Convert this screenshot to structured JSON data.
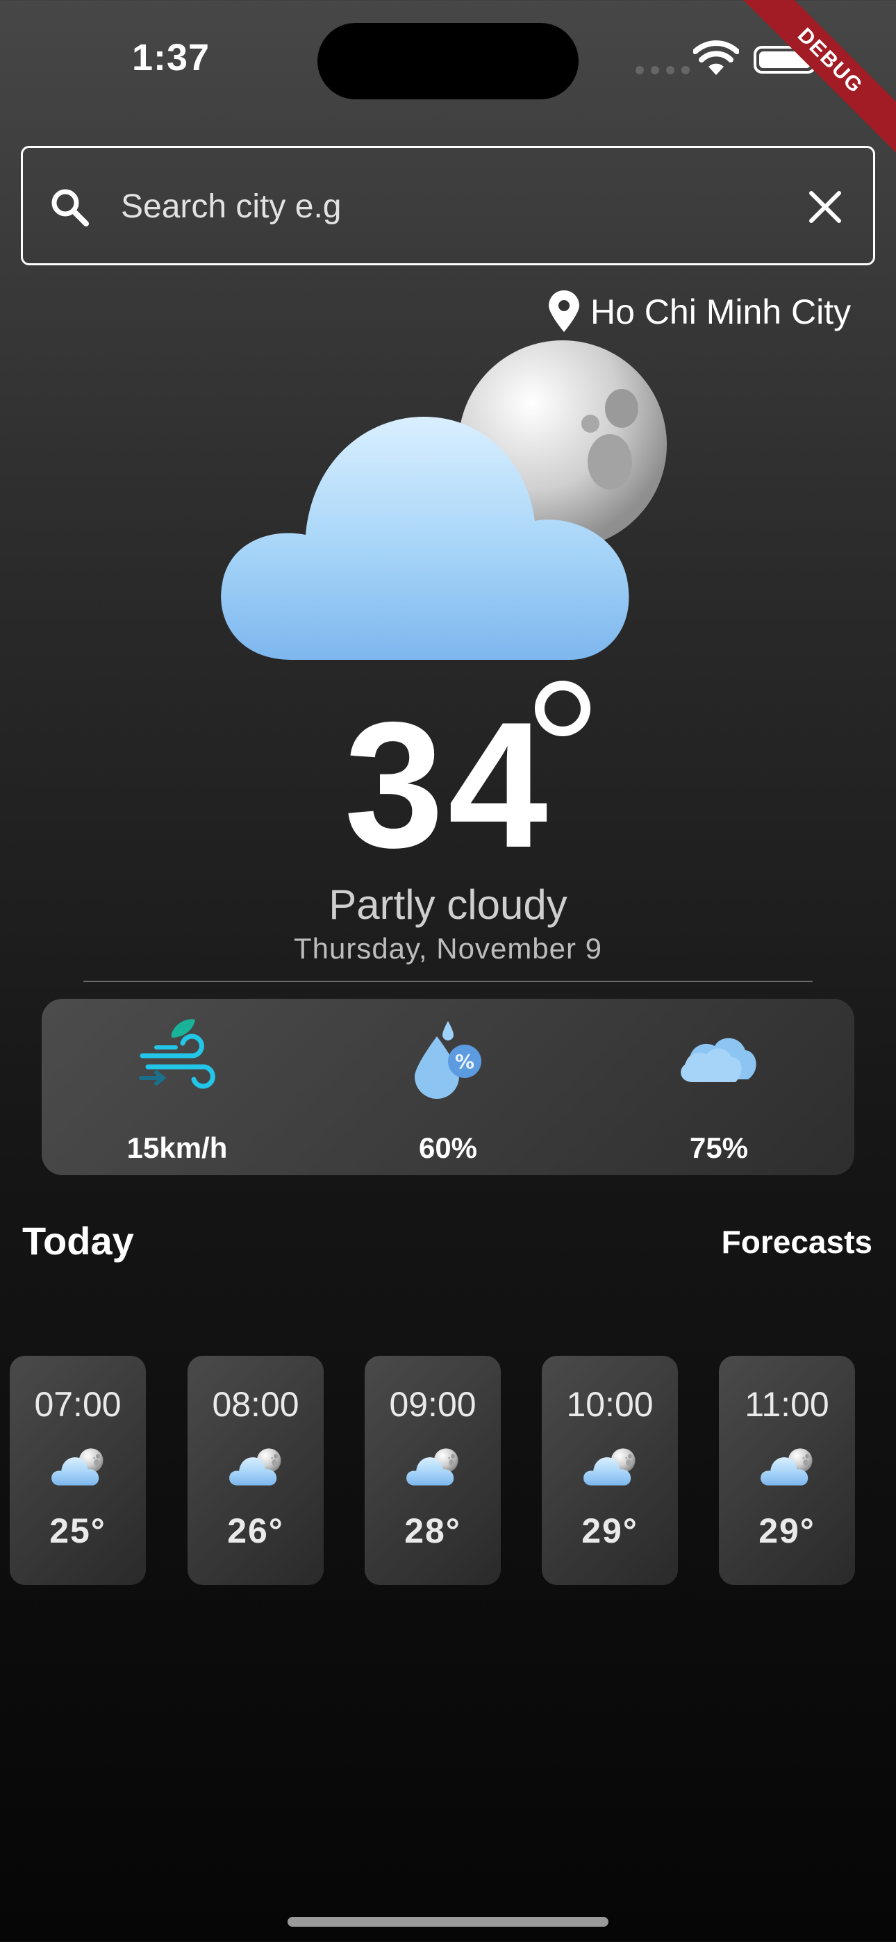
{
  "status_bar": {
    "time": "1:37"
  },
  "debug_banner": "DEBUG",
  "search": {
    "placeholder": "Search city e.g"
  },
  "location": {
    "city": "Ho Chi Minh City"
  },
  "current": {
    "temperature": "34",
    "condition": "Partly cloudy",
    "date": "Thursday, November 9",
    "icon": "cloud-moon-icon"
  },
  "stats": [
    {
      "icon": "wind-icon",
      "value": "15km/h"
    },
    {
      "icon": "humidity-icon",
      "value": "60%"
    },
    {
      "icon": "cloud-icon",
      "value": "75%"
    }
  ],
  "today": {
    "title": "Today",
    "forecasts_link": "Forecasts"
  },
  "hourly": [
    {
      "hour": "07:00",
      "temp": "25°",
      "icon": "cloud-moon-icon"
    },
    {
      "hour": "08:00",
      "temp": "26°",
      "icon": "cloud-moon-icon"
    },
    {
      "hour": "09:00",
      "temp": "28°",
      "icon": "cloud-moon-icon"
    },
    {
      "hour": "10:00",
      "temp": "29°",
      "icon": "cloud-moon-icon"
    },
    {
      "hour": "11:00",
      "temp": "29°",
      "icon": "cloud-moon-icon"
    }
  ],
  "colors": {
    "background_top": "#474747",
    "background_bottom": "#060606",
    "cloud_blue": "#8cc4f2",
    "debug_red": "#a11c24"
  }
}
